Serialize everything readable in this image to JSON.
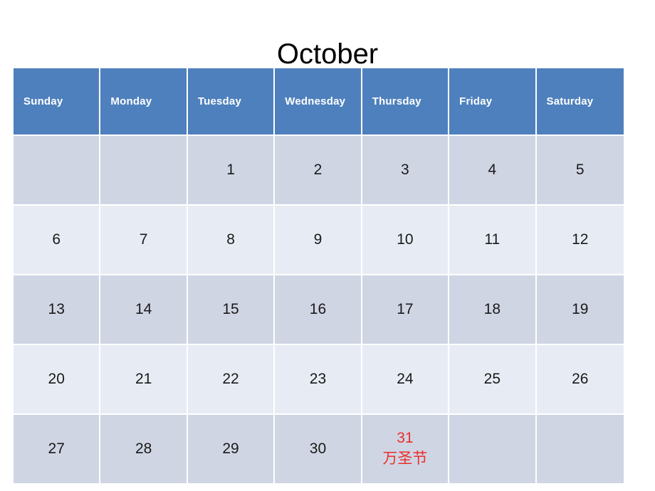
{
  "title": "October",
  "weekday_headers": [
    "Sunday",
    "Monday",
    "Tuesday",
    "Wednesday",
    "Thursday",
    "Friday",
    "Saturday"
  ],
  "colors": {
    "header_blue": "#4e80bd",
    "row_dark": "#d0d5e4",
    "row_light": "#e7ecf4",
    "holiday_red": "#e8302a",
    "day_text": "#1a1a1a",
    "grid_line": "#ffffff",
    "page_background": "#ffffff",
    "title_text": "#000000"
  },
  "weeks": [
    {
      "shade": "row-dark",
      "days": [
        {
          "number": "",
          "note": ""
        },
        {
          "number": "",
          "note": ""
        },
        {
          "number": "1",
          "note": ""
        },
        {
          "number": "2",
          "note": ""
        },
        {
          "number": "3",
          "note": ""
        },
        {
          "number": "4",
          "note": ""
        },
        {
          "number": "5",
          "note": ""
        }
      ]
    },
    {
      "shade": "row-light",
      "days": [
        {
          "number": "6",
          "note": ""
        },
        {
          "number": "7",
          "note": ""
        },
        {
          "number": "8",
          "note": ""
        },
        {
          "number": "9",
          "note": ""
        },
        {
          "number": "10",
          "note": ""
        },
        {
          "number": "11",
          "note": ""
        },
        {
          "number": "12",
          "note": ""
        }
      ]
    },
    {
      "shade": "row-dark",
      "days": [
        {
          "number": "13",
          "note": ""
        },
        {
          "number": "14",
          "note": ""
        },
        {
          "number": "15",
          "note": ""
        },
        {
          "number": "16",
          "note": ""
        },
        {
          "number": "17",
          "note": ""
        },
        {
          "number": "18",
          "note": ""
        },
        {
          "number": "19",
          "note": ""
        }
      ]
    },
    {
      "shade": "row-light",
      "days": [
        {
          "number": "20",
          "note": ""
        },
        {
          "number": "21",
          "note": ""
        },
        {
          "number": "22",
          "note": ""
        },
        {
          "number": "23",
          "note": ""
        },
        {
          "number": "24",
          "note": ""
        },
        {
          "number": "25",
          "note": ""
        },
        {
          "number": "26",
          "note": ""
        }
      ]
    },
    {
      "shade": "row-dark",
      "days": [
        {
          "number": "27",
          "note": ""
        },
        {
          "number": "28",
          "note": ""
        },
        {
          "number": "29",
          "note": ""
        },
        {
          "number": "30",
          "note": ""
        },
        {
          "number": "31",
          "note": "万圣节"
        },
        {
          "number": "",
          "note": ""
        },
        {
          "number": "",
          "note": ""
        }
      ]
    }
  ]
}
